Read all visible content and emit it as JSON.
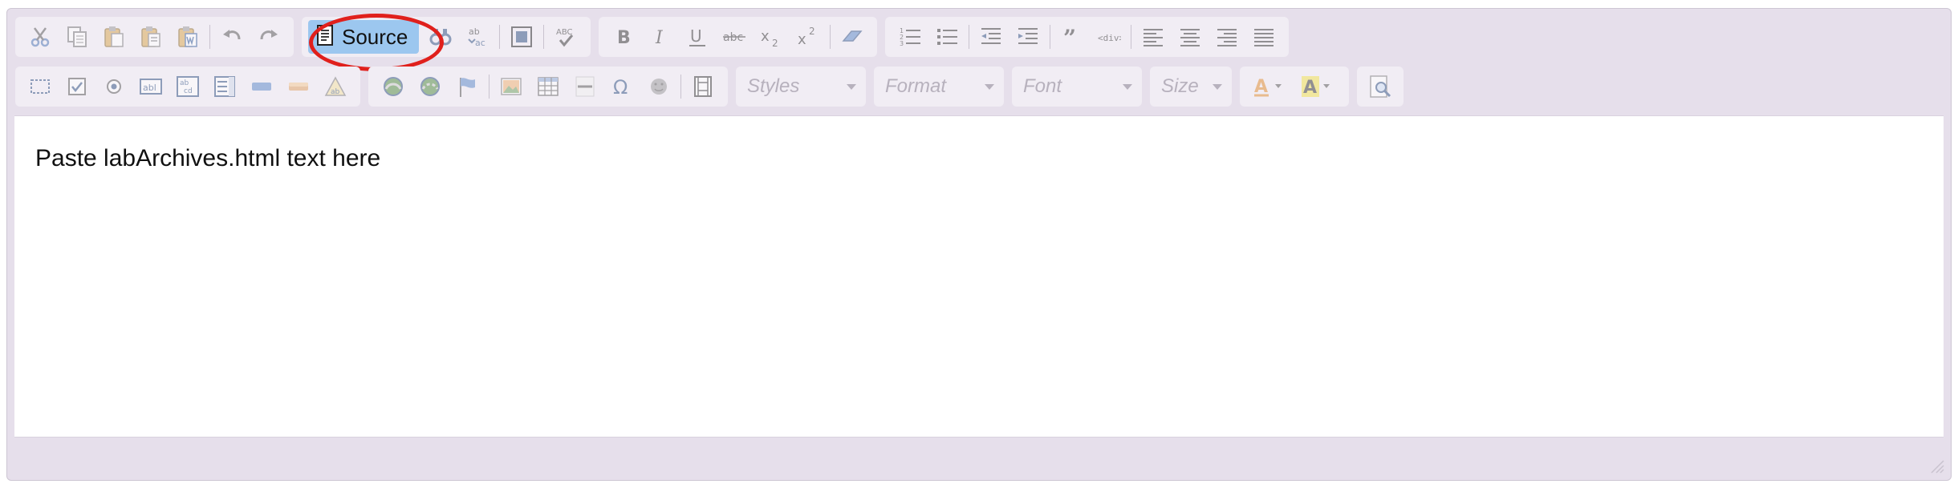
{
  "toolbar": {
    "source_label": "Source",
    "row1_icons": {
      "clipboard": [
        "cut-icon",
        "copy-icon",
        "paste-icon",
        "paste-text-icon",
        "paste-from-word-icon"
      ],
      "history": [
        "undo-icon",
        "redo-icon"
      ],
      "find": [
        "find-icon",
        "replace-icon",
        "select-all-icon",
        "spellcheck-icon"
      ],
      "basic_styles": [
        "bold-icon",
        "italic-icon",
        "underline-icon",
        "strikethrough-icon",
        "subscript-icon",
        "superscript-icon",
        "remove-format-icon"
      ],
      "paragraph": [
        "numbered-list-icon",
        "bulleted-list-icon",
        "decrease-indent-icon",
        "increase-indent-icon",
        "blockquote-icon",
        "create-div-icon",
        "align-left-icon",
        "align-center-icon",
        "align-right-icon",
        "justify-icon"
      ]
    },
    "row2_icons": {
      "forms": [
        "form-icon",
        "checkbox-icon",
        "radio-icon",
        "text-field-icon",
        "textarea-icon",
        "select-icon",
        "button-icon",
        "image-button-icon",
        "hidden-field-icon"
      ],
      "insert": [
        "link-icon",
        "unlink-icon",
        "anchor-icon",
        "image-icon",
        "table-icon",
        "horizontal-rule-icon",
        "special-char-icon",
        "smiley-icon",
        "iframe-icon"
      ],
      "colors": [
        "text-color-icon",
        "background-color-icon"
      ],
      "tools": [
        "preview-icon"
      ]
    },
    "combos": {
      "styles": "Styles",
      "format": "Format",
      "font": "Font",
      "size": "Size"
    }
  },
  "editor": {
    "content_text": "Paste labArchives.html text here"
  },
  "colors": {
    "chrome": "#e6dfeb",
    "toolbar_group": "#f1edf4",
    "source_active": "#9cc7ef",
    "highlight_ring": "#e0201c"
  }
}
